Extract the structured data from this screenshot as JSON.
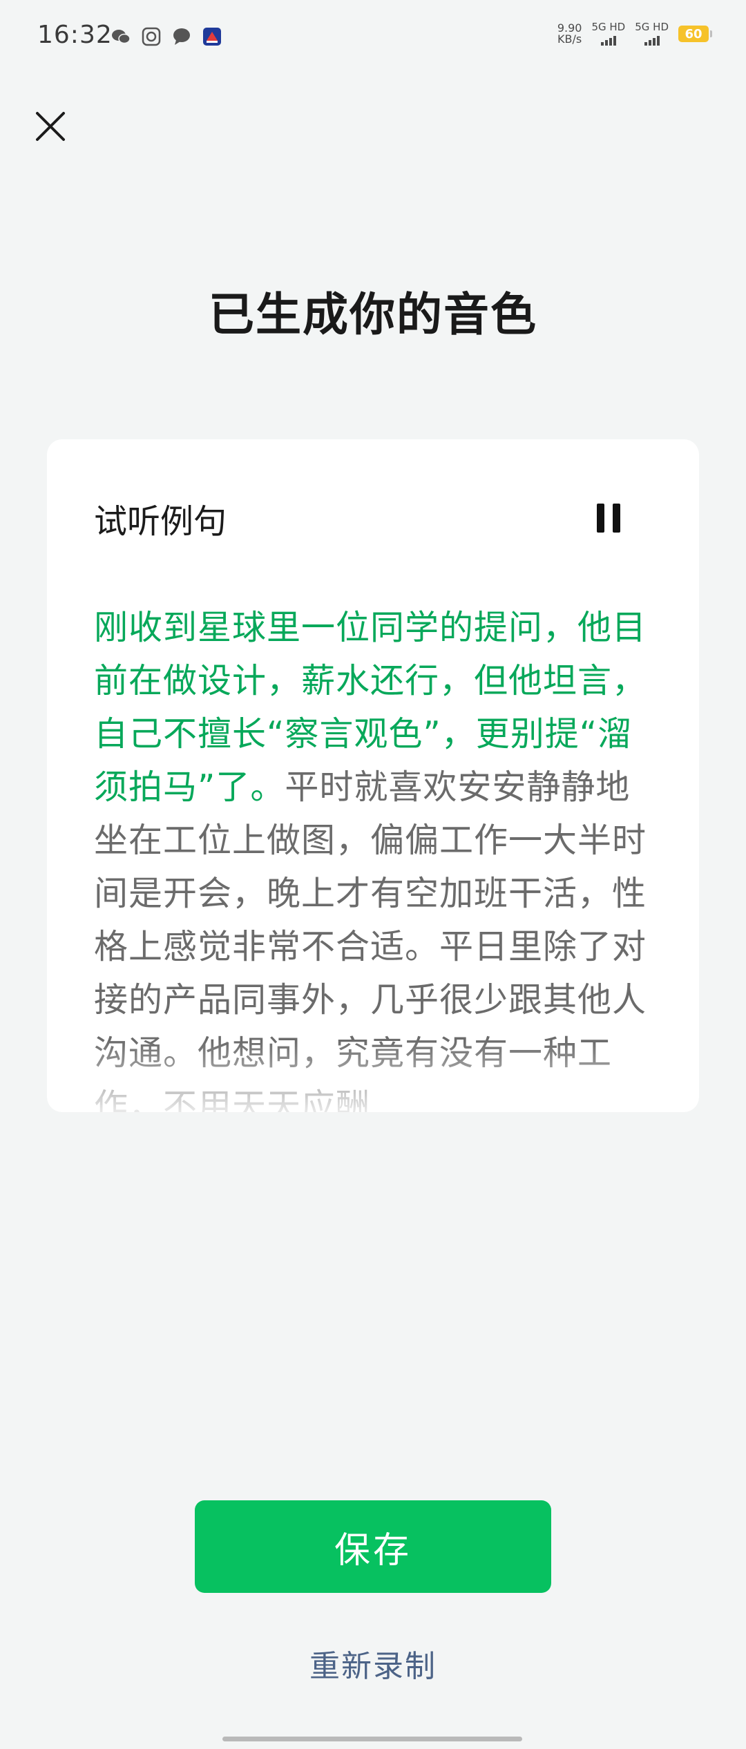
{
  "status_bar": {
    "time": "16:32",
    "left_icons": [
      "wechat-icon",
      "camera-app-icon",
      "chat-bubble-icon",
      "app-badge-icon"
    ],
    "net_speed_value": "9.90",
    "net_speed_unit": "KB/s",
    "sim1_label": "5G HD",
    "sim2_label": "5G HD",
    "battery": "60",
    "battery_color": "#f6c22a"
  },
  "header": {
    "close_icon": "close-icon"
  },
  "page": {
    "title": "已生成你的音色"
  },
  "card": {
    "label": "试听例句",
    "pause_icon": "pause-icon",
    "text_played": "刚收到星球里一位同学的提问，他目前在做设计，薪水还行，但他坦言，自己不擅长“察言观色”，更别提“溜须拍马”了。",
    "text_unplayed": "平时就喜欢安安静静地坐在工位上做图，偏偏工作一大半时间是开会，晚上才有空加班干活，性格上感觉非常不合适。平日里除了对接的产品同事外，几乎很少跟其他人沟通。他想问，究竟有没有一种工作，不用天天应酬",
    "played_color": "#07a85a",
    "unplayed_color": "#6b6b6b"
  },
  "actions": {
    "save_label": "保存",
    "save_color": "#07c160",
    "rerecord_label": "重新录制",
    "rerecord_color": "#4c6387"
  }
}
